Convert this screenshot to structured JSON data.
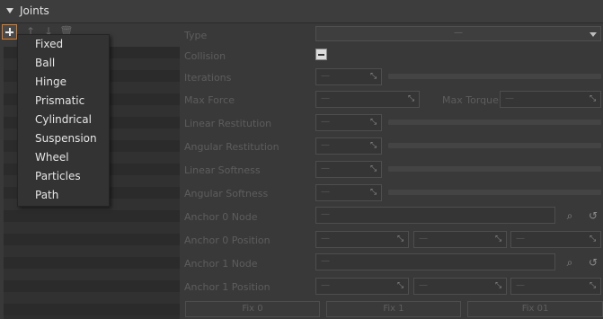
{
  "section": {
    "title": "Joints"
  },
  "toolbar": {
    "add_icon": "plus-icon",
    "up_icon": "arrow-up-icon",
    "down_icon": "arrow-down-icon",
    "delete_icon": "trash-icon",
    "up_glyph": "↑",
    "down_glyph": "↓",
    "delete_glyph": "🗑"
  },
  "menu": {
    "items": [
      "Fixed",
      "Ball",
      "Hinge",
      "Prismatic",
      "Cylindrical",
      "Suspension",
      "Wheel",
      "Particles",
      "Path"
    ]
  },
  "properties": {
    "type_label": "Type",
    "type_value": "—",
    "collision_label": "Collision",
    "iterations_label": "Iterations",
    "iterations_value": "—",
    "max_force_label": "Max Force",
    "max_force_value": "—",
    "max_torque_label": "Max Torque",
    "max_torque_value": "—",
    "linear_restitution_label": "Linear Restitution",
    "linear_restitution_value": "—",
    "angular_restitution_label": "Angular Restitution",
    "angular_restitution_value": "—",
    "linear_softness_label": "Linear Softness",
    "linear_softness_value": "—",
    "angular_softness_label": "Angular Softness",
    "angular_softness_value": "—",
    "anchor0_node_label": "Anchor 0 Node",
    "anchor0_node_value": "—",
    "anchor0_position_label": "Anchor 0 Position",
    "anchor0_position_values": [
      "—",
      "—",
      "—"
    ],
    "anchor1_node_label": "Anchor 1 Node",
    "anchor1_node_value": "—",
    "anchor1_position_label": "Anchor 1 Position",
    "anchor1_position_values": [
      "—",
      "—",
      "—"
    ]
  },
  "buttons": {
    "fix0": "Fix 0",
    "fix1": "Fix 1",
    "fix01": "Fix 01"
  },
  "glyphs": {
    "drag": "⤡",
    "search": "⌕",
    "reset": "↺"
  }
}
